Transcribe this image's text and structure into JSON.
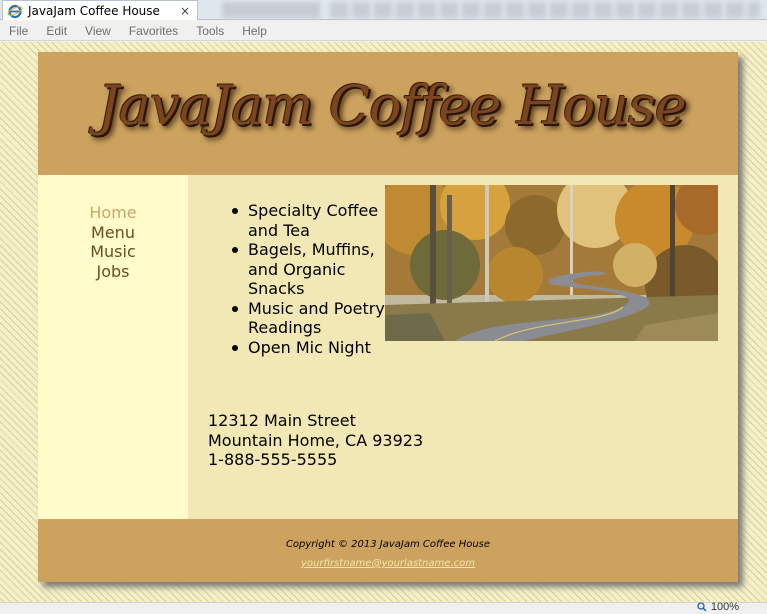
{
  "browser": {
    "tab_title": "JavaJam Coffee House",
    "tab_icon": "internet-explorer-icon",
    "close_glyph": "×",
    "menu": [
      "File",
      "Edit",
      "View",
      "Favorites",
      "Tools",
      "Help"
    ],
    "zoom_level": "100%"
  },
  "site": {
    "logo_text": "JavaJam Coffee House",
    "nav": [
      {
        "label": "Home",
        "current": true
      },
      {
        "label": "Menu",
        "current": false
      },
      {
        "label": "Music",
        "current": false
      },
      {
        "label": "Jobs",
        "current": false
      }
    ],
    "features": [
      "Specialty Coffee and Tea",
      "Bagels, Muffins, and Organic Snacks",
      "Music and Poetry Readings",
      "Open Mic Night"
    ],
    "address": {
      "street": "12312 Main Street",
      "city": "Mountain Home, CA 93923",
      "phone": "1-888-555-5555"
    },
    "footer": {
      "copyright": "Copyright © 2013 JavaJam Coffee House",
      "email": "yourfirstname@yourlastname.com"
    }
  },
  "colors": {
    "header_footer": "#cca25e",
    "nav_bg": "#fffcc9",
    "content_bg": "#f2e8b5",
    "nav_current": "#c9a66d",
    "nav_link": "#6b4b2a"
  }
}
